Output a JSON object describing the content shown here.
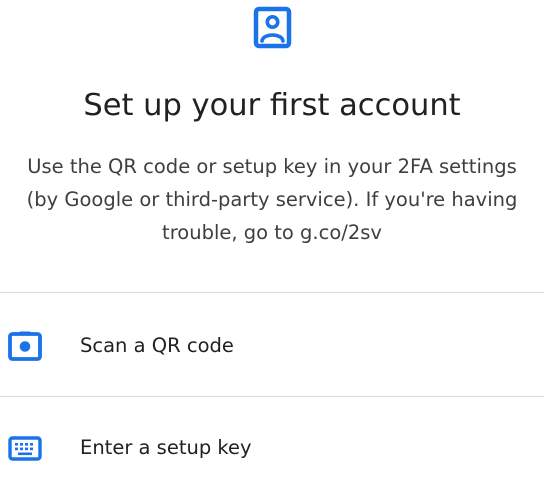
{
  "header": {
    "icon": "account-box-icon",
    "accent_color": "#1a73e8"
  },
  "title": "Set up your first account",
  "description": {
    "line1": "Use the QR code or setup key in your 2FA settings",
    "line2": "(by Google or third-party service). If you're having",
    "line3": "trouble, go to g.co/2sv"
  },
  "options": [
    {
      "label": "Scan a QR code",
      "icon": "camera-icon"
    },
    {
      "label": "Enter a setup key",
      "icon": "keyboard-icon"
    }
  ]
}
